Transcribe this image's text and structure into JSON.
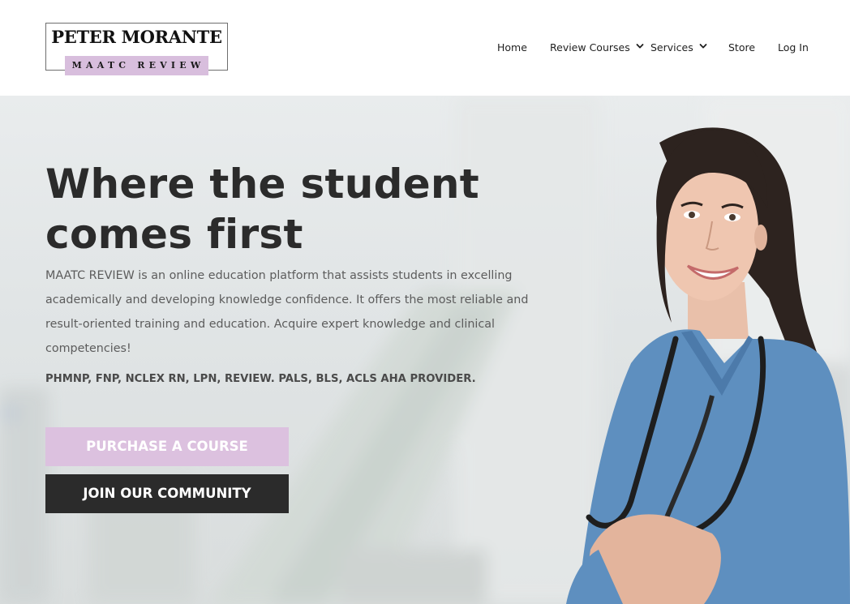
{
  "header": {
    "logo": {
      "name": "PETER MORANTE",
      "subtitle": "MAATC REVIEW"
    },
    "nav": [
      {
        "label": "Home",
        "has_dropdown": false
      },
      {
        "label": "Review Courses",
        "has_dropdown": true
      },
      {
        "label": "Services",
        "has_dropdown": true
      },
      {
        "label": "Store",
        "has_dropdown": false
      },
      {
        "label": "Log In",
        "has_dropdown": false
      }
    ]
  },
  "hero": {
    "headline_line1": "Where the student",
    "headline_line2": "comes first",
    "description": "MAATC REVIEW is an online education platform that assists students in excelling academically and developing knowledge confidence. It offers the most reliable and result-oriented training and education. Acquire expert knowledge and clinical competencies!",
    "credentials": "PHMNP, FNP, NCLEX RN, LPN, REVIEW. PALS, BLS, ACLS AHA PROVIDER.",
    "purchase_button": "PURCHASE A COURSE",
    "join_button": "JOIN OUR COMMUNITY"
  },
  "colors": {
    "accent_lavender": "#dcc1df",
    "dark_button": "#2b2b2b",
    "scrub_blue": "#5e8fbf",
    "text_dark": "#2b2b2b"
  }
}
